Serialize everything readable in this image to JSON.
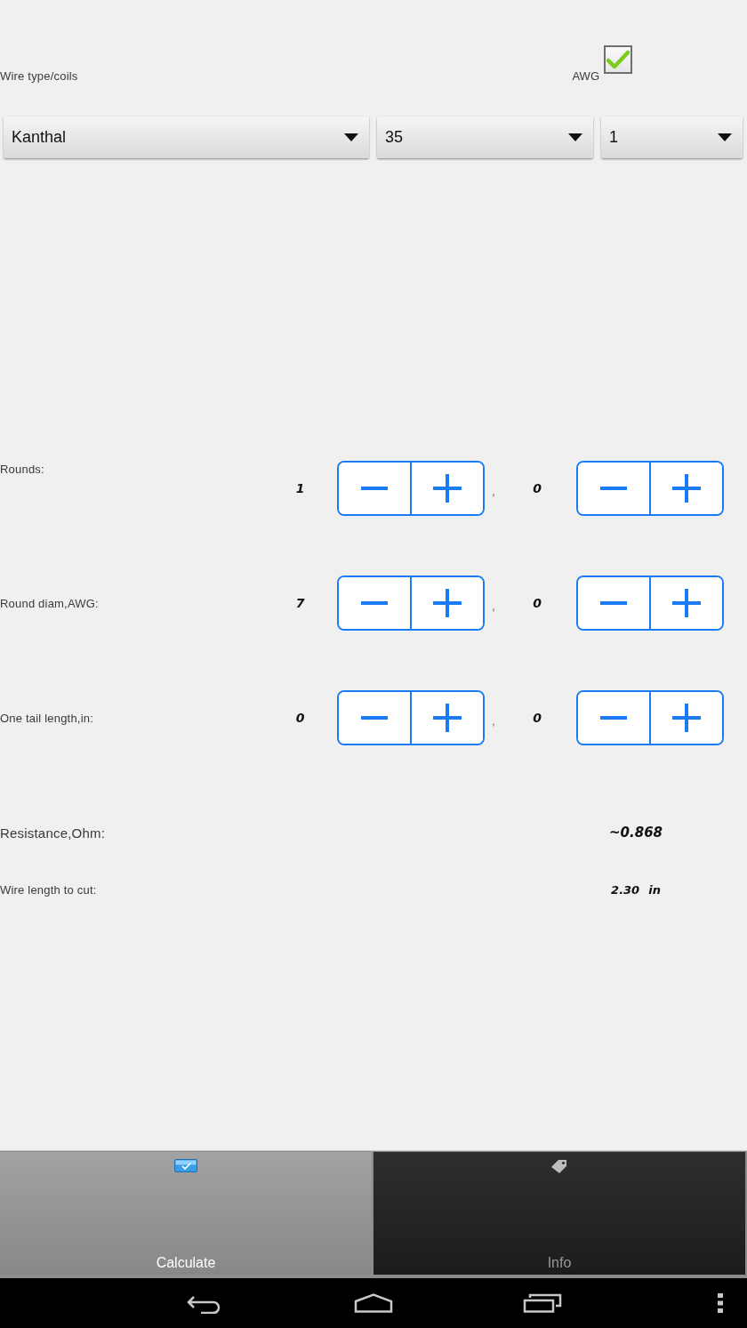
{
  "header": {
    "title": "Wire type/coils",
    "awg_label": "AWG",
    "awg_checked": true
  },
  "dropdowns": [
    {
      "value": "Kanthal"
    },
    {
      "value": "35"
    },
    {
      "value": "1"
    }
  ],
  "steppers": [
    {
      "label": "Rounds:",
      "whole": "1",
      "separator": ",",
      "decimal": "0"
    },
    {
      "label": "Round diam,AWG:",
      "whole": "7",
      "separator": ",",
      "decimal": "0"
    },
    {
      "label": "One tail length,in:",
      "whole": "0",
      "separator": ",",
      "decimal": "0"
    }
  ],
  "results": [
    {
      "label": "Resistance,Ohm:",
      "value": "~0.868",
      "kind": "large"
    },
    {
      "label": "Wire length to cut:",
      "value": "2.30",
      "unit": "in",
      "kind": "small"
    }
  ],
  "tabs": [
    {
      "label": "Calculate",
      "selected": true
    },
    {
      "label": "Info",
      "selected": false
    }
  ]
}
